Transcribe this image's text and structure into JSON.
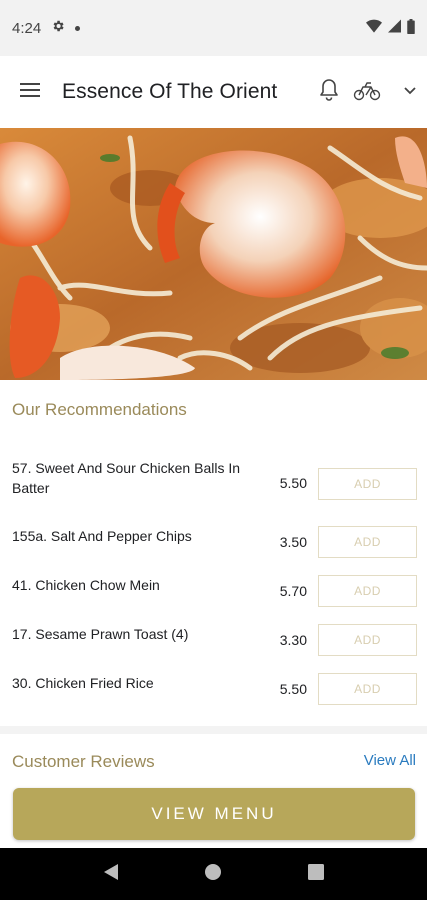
{
  "status_bar": {
    "time": "4:24"
  },
  "app_bar": {
    "title": "Essence Of The Orient"
  },
  "recommendations": {
    "title": "Our Recommendations",
    "items": [
      {
        "name": "57. Sweet And Sour Chicken Balls In Batter",
        "price": "5.50",
        "add_label": "ADD"
      },
      {
        "name": "155a. Salt And Pepper Chips",
        "price": "3.50",
        "add_label": "ADD"
      },
      {
        "name": "41. Chicken Chow Mein",
        "price": "5.70",
        "add_label": "ADD"
      },
      {
        "name": "17. Sesame Prawn Toast (4)",
        "price": "3.30",
        "add_label": "ADD"
      },
      {
        "name": "30. Chicken Fried Rice",
        "price": "5.50",
        "add_label": "ADD"
      }
    ]
  },
  "reviews": {
    "title": "Customer Reviews",
    "view_all_label": "View All"
  },
  "cta": {
    "view_menu_label": "VIEW MENU"
  },
  "colors": {
    "accent_gold": "#b7a75a",
    "heading_gold": "#9a8a5a",
    "link_blue": "#2a7bbf"
  },
  "icons": [
    "gear-icon",
    "menu-icon",
    "bell-icon",
    "delivery-icon",
    "chevron-down-icon",
    "wifi-icon",
    "signal-icon",
    "battery-icon",
    "back-icon",
    "home-icon",
    "recents-icon"
  ]
}
